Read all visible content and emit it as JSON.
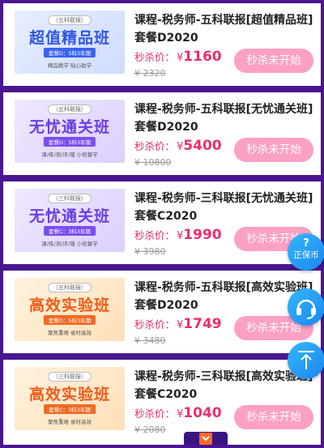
{
  "items": [
    {
      "thumb": {
        "tag": "（五科联报）",
        "big": "超值精品班",
        "plan": "套餐D：5科3年期",
        "sub": "精品教学   贴心助学"
      },
      "title": "课程-税务师-五科联报[超值精品班]套餐D2020",
      "price_label": "秒杀价：",
      "currency": "¥",
      "price": "1160",
      "orig_price": "¥ 2320",
      "button": "秒杀未开始"
    },
    {
      "thumb": {
        "tag": "（五科联报）",
        "big": "无忧通关班",
        "plan": "套餐D：5科3年期",
        "sub": "课/练/测/评/辅   小班督学"
      },
      "title": "课程-税务师-五科联报[无忧通关班]套餐D2020",
      "price_label": "秒杀价：",
      "currency": "¥",
      "price": "5400",
      "orig_price": "¥ 10800",
      "button": "秒杀未开始"
    },
    {
      "thumb": {
        "tag": "（三科联报）",
        "big": "无忧通关班",
        "plan": "套餐C：3科3年期",
        "sub": "课/练/测/评/辅   小班督学"
      },
      "title": "课程-税务师-三科联报[无忧通关班]套餐C2020",
      "price_label": "秒杀价：",
      "currency": "¥",
      "price": "1990",
      "orig_price": "¥ 3980",
      "button": "秒杀未开始"
    },
    {
      "thumb": {
        "tag": "（五科联报）",
        "big": "高效实验班",
        "plan": "套餐D：5科3年期",
        "sub": "聚焦重难   省时高效"
      },
      "title": "课程-税务师-五科联报[高效实验班]套餐D2020",
      "price_label": "秒杀价：",
      "currency": "¥",
      "price": "1749",
      "orig_price": "¥ 3480",
      "button": "秒杀未开始"
    },
    {
      "thumb": {
        "tag": "（三科联报）",
        "big": "高效实验班",
        "plan": "套餐C：3科3年期",
        "sub": "聚焦重难   省时高效"
      },
      "title": "课程-税务师-三科联报[高效实验班]套餐C2020",
      "price_label": "秒杀价：",
      "currency": "¥",
      "price": "1040",
      "orig_price": "¥ 2080",
      "button": "秒杀未开始"
    }
  ],
  "floating": {
    "coin_symbol": "?",
    "coin_label": "正保币"
  },
  "colors": {
    "background": "#4a1690",
    "price": "#ec2e6d",
    "button": "#fca0c4",
    "float_button": "#1a86ee"
  }
}
